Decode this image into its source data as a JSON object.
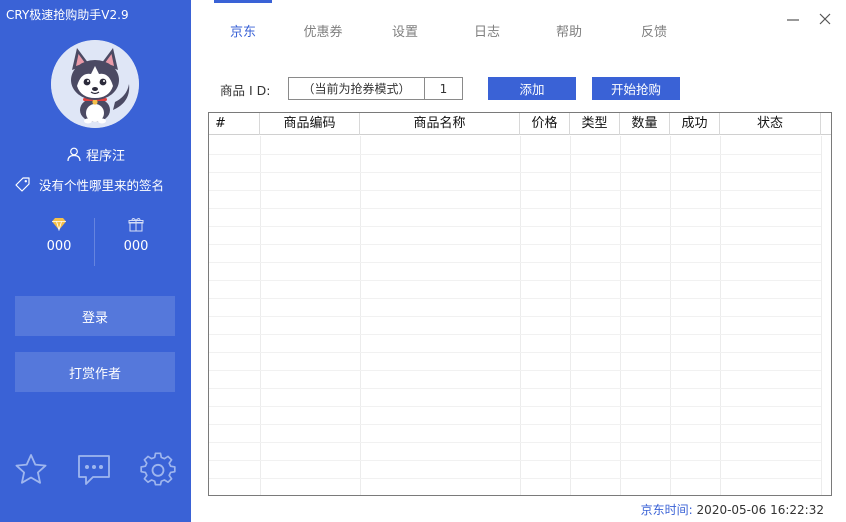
{
  "window": {
    "title": "CRY极速抢购助手V2.9"
  },
  "sidebar": {
    "username": "程序汪",
    "signature": "没有个性哪里来的签名",
    "stats": [
      {
        "icon": "diamond-icon",
        "value": "000"
      },
      {
        "icon": "gift-icon",
        "value": "000"
      }
    ],
    "buttons": {
      "login": "登录",
      "donate": "打赏作者"
    },
    "bottom_icons": [
      "star-icon",
      "chat-icon",
      "gear-icon"
    ]
  },
  "tabs": [
    {
      "label": "京东",
      "active": true
    },
    {
      "label": "优惠券",
      "active": false
    },
    {
      "label": "设置",
      "active": false
    },
    {
      "label": "日志",
      "active": false
    },
    {
      "label": "帮助",
      "active": false
    },
    {
      "label": "反馈",
      "active": false
    }
  ],
  "toolbar": {
    "product_id_label": "商品 I D:",
    "mode_value": "（当前为抢券模式）",
    "quantity_value": "1",
    "add_label": "添加",
    "start_label": "开始抢购"
  },
  "table": {
    "columns": [
      "#",
      "商品编码",
      "商品名称",
      "价格",
      "类型",
      "数量",
      "成功",
      "状态"
    ],
    "rows": []
  },
  "status_bar": {
    "label": "京东时间:",
    "time": "2020-05-06 16:22:32"
  },
  "colors": {
    "accent": "#3a62d6",
    "sidebar_bg": "#3a62d6",
    "diamond": "#f5c04a"
  }
}
